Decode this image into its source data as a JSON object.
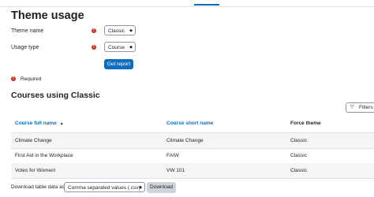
{
  "page_title": "Theme usage",
  "form": {
    "theme_name_label": "Theme name",
    "theme_name_value": "Classic",
    "usage_type_label": "Usage type",
    "usage_type_value": "Course",
    "required_marker": "!",
    "submit_label": "Get report",
    "required_note": "Required"
  },
  "section_title": "Courses using Classic",
  "filters_label": "Filters",
  "table": {
    "headers": [
      "Course full name",
      "Course short name",
      "Force theme"
    ],
    "rows": [
      [
        "Climate Change",
        "Climate Change",
        "Classic"
      ],
      [
        "First Aid in the Workplace",
        "FAIW",
        "Classic"
      ],
      [
        "Votes for Women!",
        "VW 101",
        "Classic"
      ]
    ]
  },
  "download": {
    "label": "Download table data as",
    "format_value": "Comma separated values (.csv)",
    "button_label": "Download"
  },
  "icons": {
    "required": "exclamation-circle-icon",
    "sort": "sort-ascending-icon",
    "filter": "filter-icon",
    "caret": "chevron-down-icon"
  },
  "colors": {
    "primary": "#0f6cbf",
    "required": "#ca3120",
    "secondary_button": "#ced4da"
  }
}
